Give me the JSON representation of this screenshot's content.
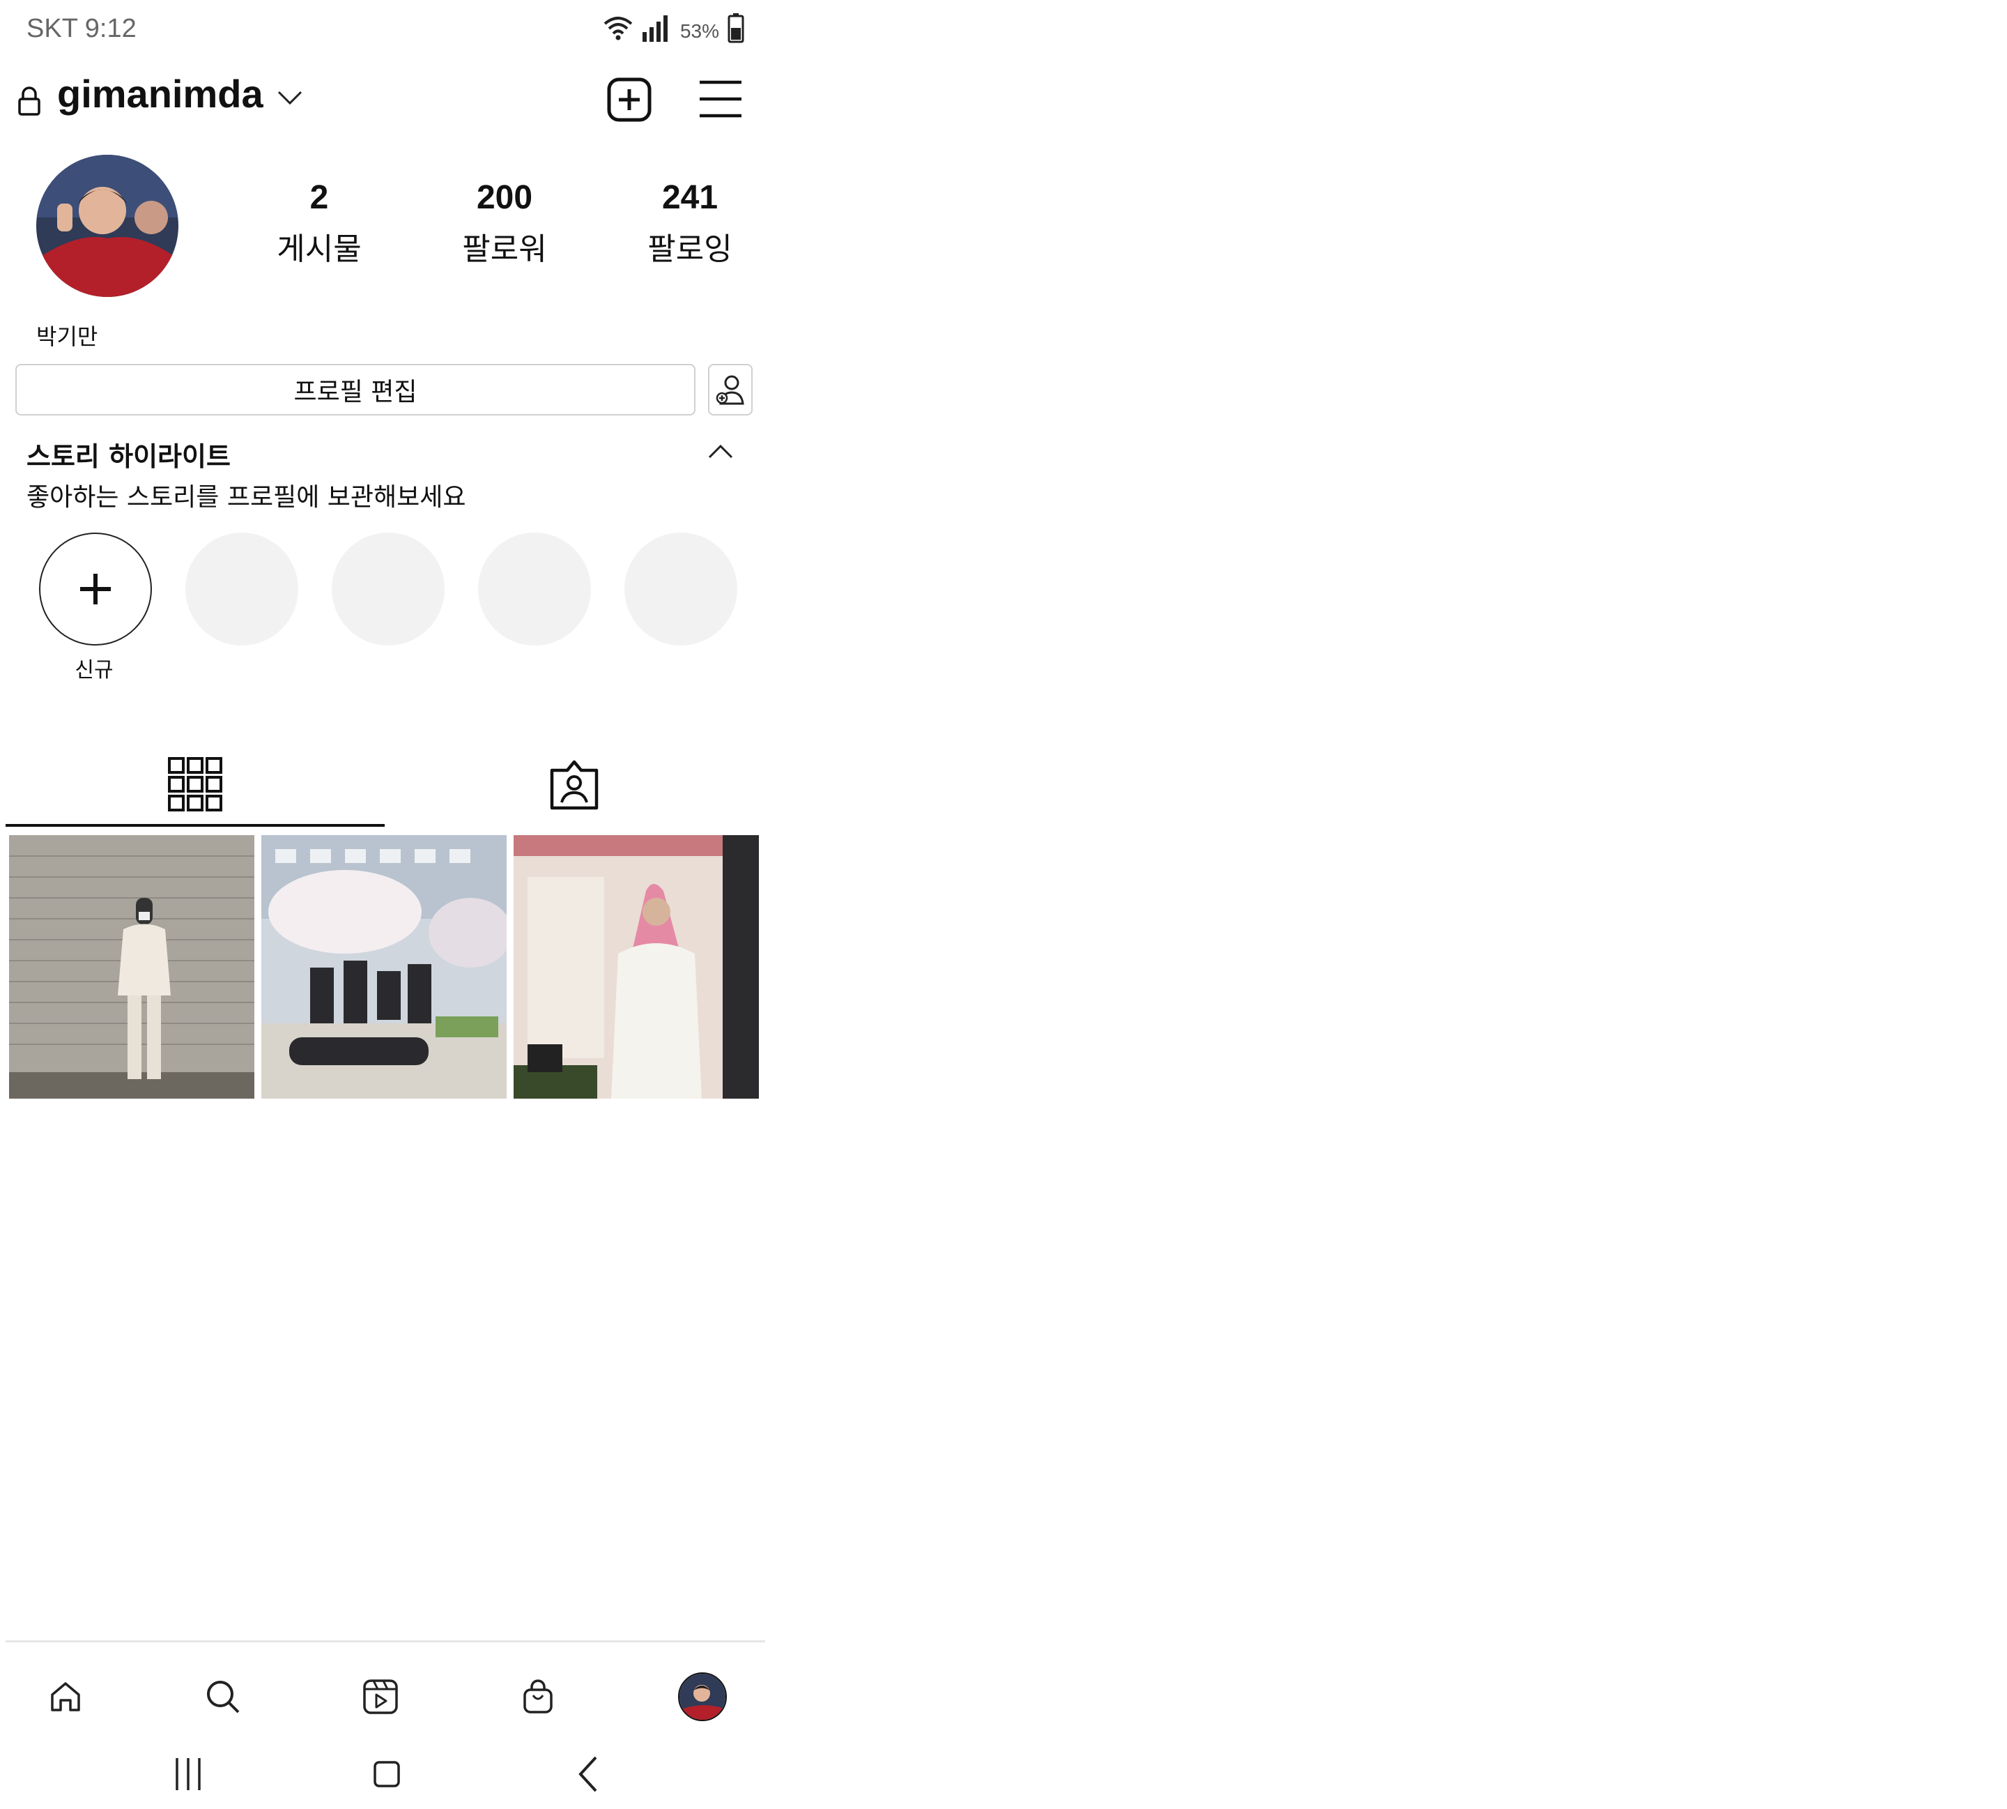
{
  "status_bar": {
    "carrier_time": "SKT 9:12",
    "battery_percent": "53%"
  },
  "header": {
    "username": "gimanimda"
  },
  "profile": {
    "stats": [
      {
        "value": "2",
        "label": "게시물"
      },
      {
        "value": "200",
        "label": "팔로워"
      },
      {
        "value": "241",
        "label": "팔로잉"
      }
    ],
    "full_name": "박기만",
    "edit_button_label": "프로필 편집"
  },
  "highlights": {
    "title": "스토리 하이라이트",
    "subtitle": "좋아하는 스토리를 프로필에 보관해보세요",
    "new_label": "신규"
  },
  "icons": {
    "lock": "lock-icon",
    "dropdown": "chevron-down-icon",
    "new_post": "plus-square-icon",
    "menu": "hamburger-menu-icon",
    "discover_people": "add-person-icon",
    "collapse": "chevron-up-icon",
    "grid_tab": "grid-icon",
    "tagged_tab": "tagged-person-icon",
    "home": "home-icon",
    "search": "search-icon",
    "reels": "reels-icon",
    "shop": "shopping-bag-icon"
  },
  "colors": {
    "accent": "#111111",
    "placeholder": "#f2f2f2",
    "border": "#d0d0d0"
  }
}
